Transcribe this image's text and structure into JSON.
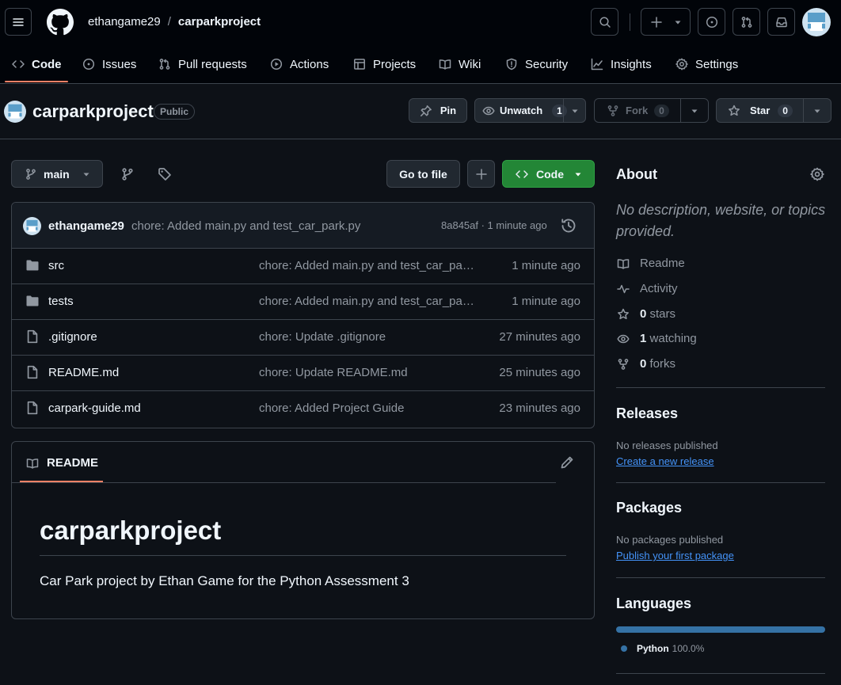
{
  "header": {
    "owner": "ethangame29",
    "separator": "/",
    "repo": "carparkproject"
  },
  "tabs": [
    {
      "label": "Code"
    },
    {
      "label": "Issues"
    },
    {
      "label": "Pull requests"
    },
    {
      "label": "Actions"
    },
    {
      "label": "Projects"
    },
    {
      "label": "Wiki"
    },
    {
      "label": "Security"
    },
    {
      "label": "Insights"
    },
    {
      "label": "Settings"
    }
  ],
  "repo_title": {
    "name": "carparkproject",
    "visibility": "Public"
  },
  "repo_actions": {
    "pin": "Pin",
    "unwatch": "Unwatch",
    "unwatch_count": "1",
    "fork": "Fork",
    "fork_count": "0",
    "star": "Star",
    "star_count": "0"
  },
  "toolbar": {
    "branch": "main",
    "go_to_file": "Go to file",
    "code": "Code"
  },
  "latest_commit": {
    "author": "ethangame29",
    "message": "chore: Added main.py and test_car_park.py",
    "hash_time": "8a845af · 1 minute ago"
  },
  "files": [
    {
      "name": "src",
      "type": "folder",
      "message": "chore: Added main.py and test_car_park.py",
      "time": "1 minute ago"
    },
    {
      "name": "tests",
      "type": "folder",
      "message": "chore: Added main.py and test_car_park.py",
      "time": "1 minute ago"
    },
    {
      "name": ".gitignore",
      "type": "file",
      "message": "chore: Update .gitignore",
      "time": "27 minutes ago"
    },
    {
      "name": "README.md",
      "type": "file",
      "message": "chore: Update README.md",
      "time": "25 minutes ago"
    },
    {
      "name": "carpark-guide.md",
      "type": "file",
      "message": "chore: Added Project Guide",
      "time": "23 minutes ago"
    }
  ],
  "readme": {
    "tab_label": "README",
    "title": "carparkproject",
    "body": "Car Park project by Ethan Game for the Python Assessment 3"
  },
  "about": {
    "heading": "About",
    "description": "No description, website, or topics provided.",
    "readme": "Readme",
    "activity": "Activity",
    "stars_count": "0",
    "stars_label": "stars",
    "watching_count": "1",
    "watching_label": "watching",
    "forks_count": "0",
    "forks_label": "forks"
  },
  "releases": {
    "heading": "Releases",
    "note": "No releases published",
    "link": "Create a new release"
  },
  "packages": {
    "heading": "Packages",
    "note": "No packages published",
    "link": "Publish your first package"
  },
  "languages": {
    "heading": "Languages",
    "items": [
      {
        "name": "Python",
        "percent": "100.0%",
        "share": 1.0,
        "color": "#3572a5"
      }
    ]
  },
  "colors": {
    "accent_underline": "#f78166",
    "code_button": "#238636",
    "link": "#4493f8"
  }
}
